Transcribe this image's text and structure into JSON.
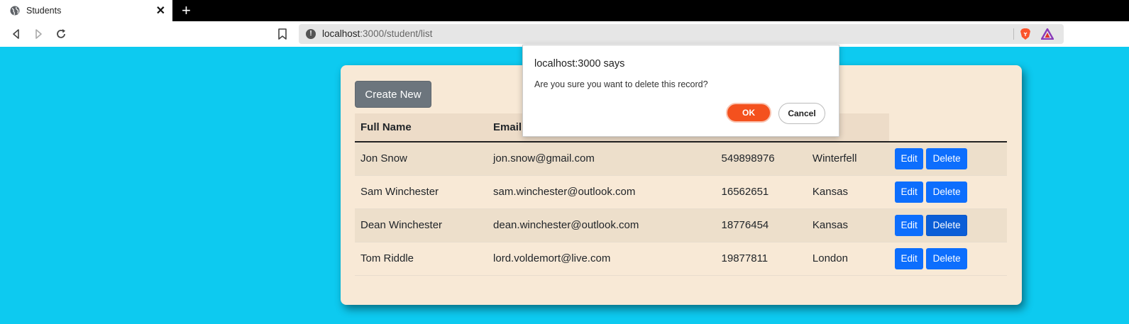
{
  "browser": {
    "tab_title": "Students",
    "close_glyph": "✕",
    "new_tab_glyph": "+",
    "url_host": "localhost",
    "url_path": ":3000/student/list"
  },
  "page": {
    "create_button": "Create New",
    "headers": [
      "Full Name",
      "Email",
      "",
      "",
      ""
    ],
    "rows": [
      {
        "name": "Jon Snow",
        "email": "jon.snow@gmail.com",
        "mobile": "549898976",
        "city": "Winterfell"
      },
      {
        "name": "Sam Winchester",
        "email": "sam.winchester@outlook.com",
        "mobile": "16562651",
        "city": "Kansas"
      },
      {
        "name": "Dean Winchester",
        "email": "dean.winchester@outlook.com",
        "mobile": "18776454",
        "city": "Kansas"
      },
      {
        "name": "Tom Riddle",
        "email": "lord.voldemort@live.com",
        "mobile": "19877811",
        "city": "London"
      }
    ],
    "edit_label": "Edit",
    "delete_label": "Delete"
  },
  "dialog": {
    "title": "localhost:3000 says",
    "message": "Are you sure you want to delete this record?",
    "ok": "OK",
    "cancel": "Cancel"
  },
  "colors": {
    "page_bg": "#0dcaf0",
    "card_bg": "#f8e9d6",
    "primary": "#0d6efd",
    "secondary": "#6c757d",
    "ok_button": "#f4511e"
  }
}
